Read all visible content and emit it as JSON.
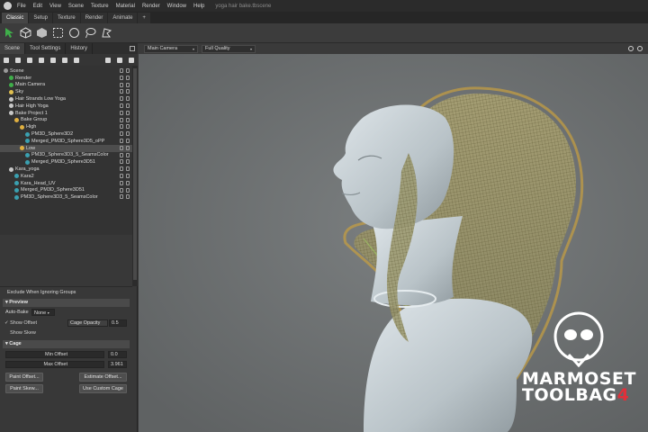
{
  "menubar": {
    "items": [
      "File",
      "Edit",
      "View",
      "Scene",
      "Texture",
      "Material",
      "Render",
      "Window",
      "Help"
    ],
    "doc_title": "yoga hair bake.tbscene"
  },
  "workspace_tabs": [
    "Classic",
    "Setup",
    "Texture",
    "Render",
    "Animate",
    "+"
  ],
  "left_panel": {
    "tabs": [
      "Scene",
      "Tool Settings",
      "History"
    ]
  },
  "tree": [
    {
      "label": "Scene",
      "indent": 0,
      "color": "#9a9a9a",
      "selected": false
    },
    {
      "label": "Render",
      "indent": 1,
      "color": "#3fae4a",
      "selected": false
    },
    {
      "label": "Main Camera",
      "indent": 1,
      "color": "#3fae4a",
      "selected": false
    },
    {
      "label": "Sky",
      "indent": 1,
      "color": "#e0c050",
      "selected": false
    },
    {
      "label": "Hair Strands Low Yoga",
      "indent": 1,
      "color": "#c8c8c8",
      "selected": false
    },
    {
      "label": "Hair High Yoga",
      "indent": 1,
      "color": "#c8c8c8",
      "selected": false
    },
    {
      "label": "Bake Project 1",
      "indent": 1,
      "color": "#c8c8c8",
      "selected": false
    },
    {
      "label": "Bake Group",
      "indent": 2,
      "color": "#e0b040",
      "selected": false
    },
    {
      "label": "High",
      "indent": 3,
      "color": "#e0b040",
      "selected": false
    },
    {
      "label": "PM3D_Sphere3D2",
      "indent": 4,
      "color": "#3aa0b0",
      "selected": false
    },
    {
      "label": "Merged_PM3D_Sphere3D5_oPP",
      "indent": 4,
      "color": "#3aa0b0",
      "selected": false
    },
    {
      "label": "Low",
      "indent": 3,
      "color": "#e0b040",
      "selected": true
    },
    {
      "label": "PM3D_Sphere3D3_5_SeamsColor",
      "indent": 4,
      "color": "#3aa0b0",
      "selected": false
    },
    {
      "label": "Merged_PM3D_Sphere3D51",
      "indent": 4,
      "color": "#3aa0b0",
      "selected": false
    },
    {
      "label": "Kara_yoga",
      "indent": 1,
      "color": "#c8c8c8",
      "selected": false
    },
    {
      "label": "Kara2",
      "indent": 2,
      "color": "#3aa0b0",
      "selected": false
    },
    {
      "label": "Kara_Head_UV",
      "indent": 2,
      "color": "#3aa0b0",
      "selected": false
    },
    {
      "label": "Merged_PM3D_Sphere3D51",
      "indent": 2,
      "color": "#3aa0b0",
      "selected": false
    },
    {
      "label": "PM3D_Sphere3D3_5_SeamsColor",
      "indent": 2,
      "color": "#3aa0b0",
      "selected": false
    }
  ],
  "props": {
    "exclude_label": "Exclude When Ignoring Groups",
    "preview_header": "Preview",
    "auto_bake_label": "Auto-Bake",
    "auto_bake_value": "None",
    "show_offset_label": "Show Offset",
    "show_offset_mark": "✓",
    "cage_opacity_label": "Cage Opacity",
    "cage_opacity_value": "0.5",
    "show_skew_label": "Show Skew",
    "cage_header": "Cage",
    "min_offset_label": "Min Offset",
    "min_offset_value": "0.0",
    "max_offset_label": "Max Offset",
    "max_offset_value": "3.961",
    "paint_offset": "Paint Offset...",
    "estimate_offset": "Estimate Offset...",
    "paint_skew": "Paint Skew...",
    "use_custom_cage": "Use Custom Cage"
  },
  "viewport": {
    "camera": "Main Camera",
    "quality": "Full Quality",
    "bg_color": "#717475",
    "cage_color": "#c8a040"
  },
  "watermark": {
    "line1": "MARMOSET",
    "line2_text": "TOOLBAG",
    "line2_num": "4"
  },
  "colors": {
    "accent": "#3fae4a",
    "brand_red": "#e0303a"
  }
}
